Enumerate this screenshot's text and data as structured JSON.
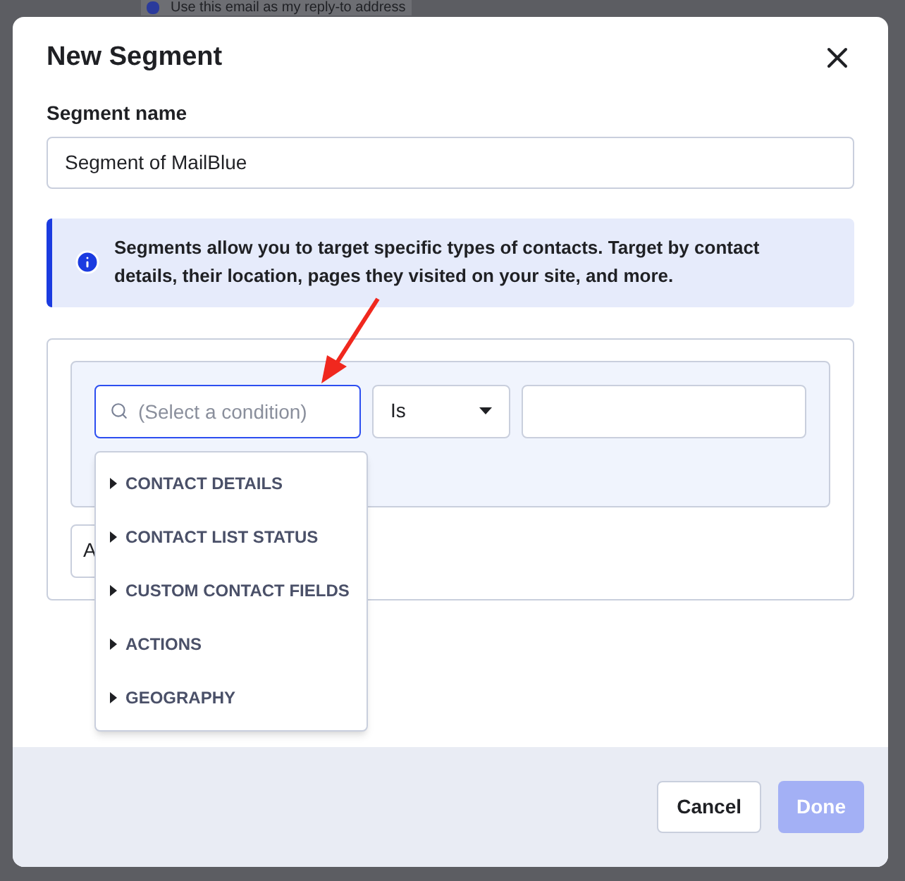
{
  "backdrop": {
    "checkbox_checked": true,
    "text": "Use this email as my reply-to address"
  },
  "dialog": {
    "title": "New Segment"
  },
  "segment_name": {
    "label": "Segment name",
    "value": "Segment of MailBlue"
  },
  "info": {
    "text": "Segments allow you to target specific types of contacts. Target by contact details, their location, pages they visited on your site, and more."
  },
  "condition": {
    "placeholder": "(Select a condition)",
    "operator": "Is"
  },
  "add_button": {
    "label": "A"
  },
  "dropdown": {
    "items": [
      {
        "label": "CONTACT DETAILS",
        "expanded": false
      },
      {
        "label": "CONTACT LIST STATUS",
        "expanded": false
      },
      {
        "label": "CUSTOM CONTACT FIELDS",
        "expanded": false
      },
      {
        "label": "ACTIONS",
        "expanded": false
      },
      {
        "label": "GEOGRAPHY",
        "expanded": false
      }
    ]
  },
  "buttons": [
    {
      "label": "Cancel",
      "kind": "secondary",
      "disabled": false
    },
    {
      "label": "Done",
      "kind": "primary",
      "disabled": true
    }
  ]
}
